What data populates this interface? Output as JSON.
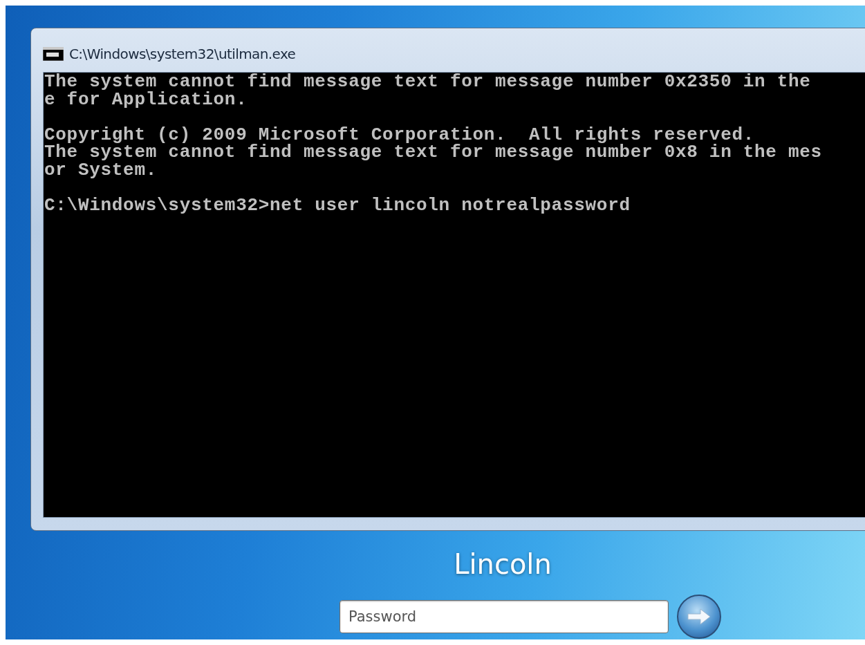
{
  "window": {
    "title": "C:\\Windows\\system32\\utilman.exe"
  },
  "console": {
    "blocks": [
      [
        "The system cannot find message text for message number 0x2350 in the",
        "e for Application."
      ],
      [
        "Copyright (c) 2009 Microsoft Corporation.  All rights reserved.",
        "The system cannot find message text for message number 0x8 in the mes",
        "or System."
      ],
      [
        "C:\\Windows\\system32>net user lincoln notrealpassword"
      ]
    ]
  },
  "login": {
    "user_name": "Lincoln",
    "password": {
      "placeholder": "Password"
    }
  }
}
